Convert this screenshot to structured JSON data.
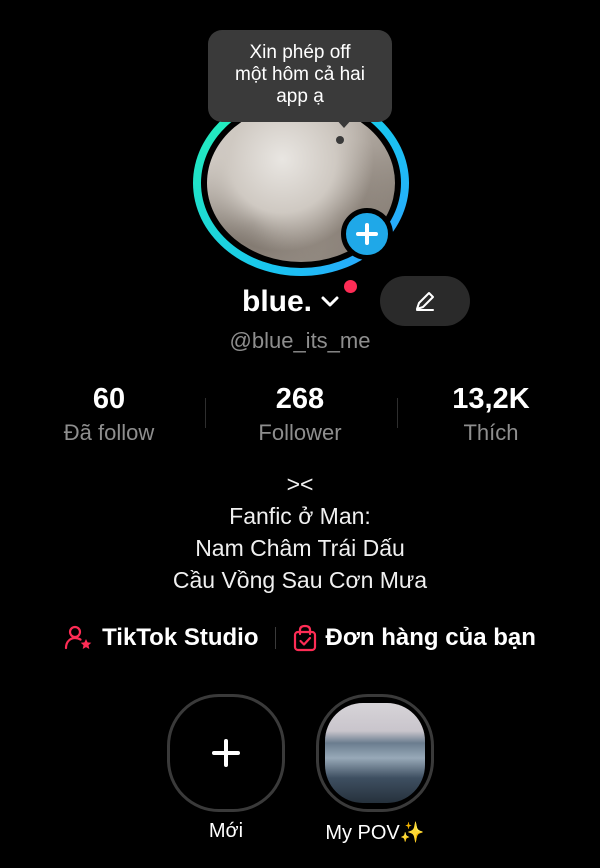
{
  "bubble": {
    "lines": [
      "Xin phép off",
      "một hôm cả hai",
      "app ạ"
    ]
  },
  "profile": {
    "display_name": "blue.",
    "username": "@blue_its_me"
  },
  "stats": [
    {
      "value": "60",
      "label": "Đã follow"
    },
    {
      "value": "268",
      "label": "Follower"
    },
    {
      "value": "13,2K",
      "label": "Thích"
    }
  ],
  "bio": [
    "><",
    "Fanfic ở Man:",
    "Nam Châm Trái Dấu",
    "Cầu Vồng Sau Cơn Mưa"
  ],
  "links": {
    "studio": "TikTok Studio",
    "orders": "Đơn hàng của bạn"
  },
  "stories": {
    "new_label": "Mới",
    "pov_label": "My POV✨"
  },
  "colors": {
    "accent_red": "#fe2c55",
    "ring_cyan": "#19c5f0",
    "ring_green": "#25f4b8",
    "plus_blue": "#1fa8e8"
  }
}
